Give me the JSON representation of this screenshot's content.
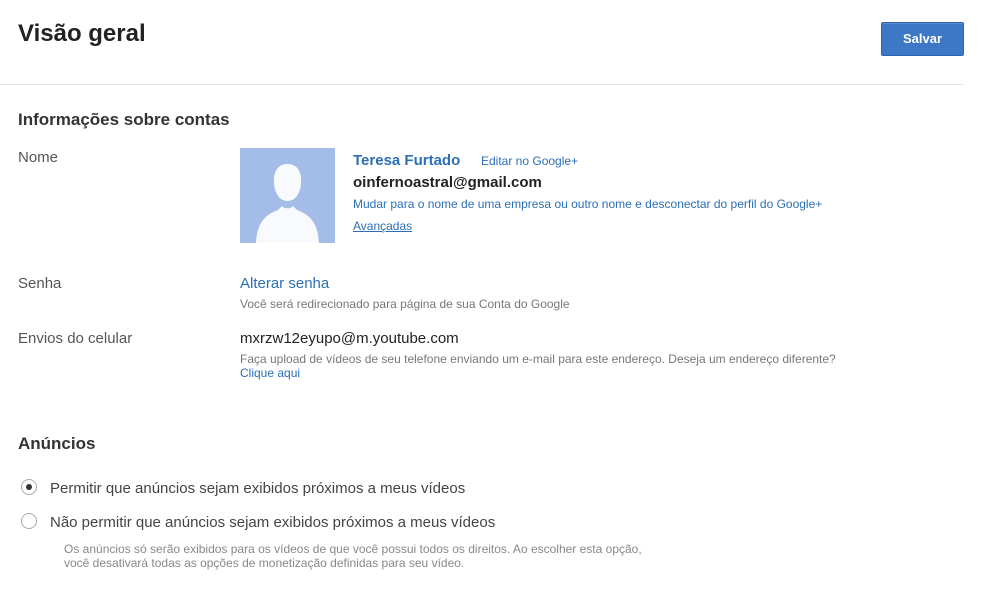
{
  "header": {
    "title": "Visão geral",
    "save_label": "Salvar"
  },
  "account_section": {
    "title": "Informações sobre contas",
    "name_label": "Nome",
    "display_name": "Teresa Furtado",
    "edit_link": "Editar no Google+",
    "email": "oinfernoastral@gmail.com",
    "switch_link": "Mudar para o nome de uma empresa ou outro nome e desconectar do perfil do Google+",
    "advanced_link": "Avançadas",
    "password_label": "Senha",
    "change_password_link": "Alterar senha",
    "password_hint": "Você será redirecionado para página de sua Conta do Google",
    "mobile_label": "Envios do celular",
    "mobile_address": "mxrzw12eyupo@m.youtube.com",
    "mobile_hint": "Faça upload de vídeos de seu telefone enviando um e-mail para este endereço. Deseja um endereço diferente?",
    "mobile_link": "Clique aqui"
  },
  "ads_section": {
    "title": "Anúncios",
    "options": [
      {
        "label": "Permitir que anúncios sejam exibidos próximos a meus vídeos",
        "selected": true
      },
      {
        "label": "Não permitir que anúncios sejam exibidos próximos a meus vídeos",
        "selected": false
      }
    ],
    "note_line1": "Os anúncios só serão exibidos para os vídeos de que você possui todos os direitos. Ao escolher esta opção,",
    "note_line2": "você desativará todas as opções de monetização definidas para seu vídeo."
  },
  "colors": {
    "primary_button": "#3d78c6",
    "link": "#2a6fb7",
    "avatar_bg": "#a4bde8"
  },
  "icons": {
    "avatar": "default-person-silhouette-icon"
  }
}
